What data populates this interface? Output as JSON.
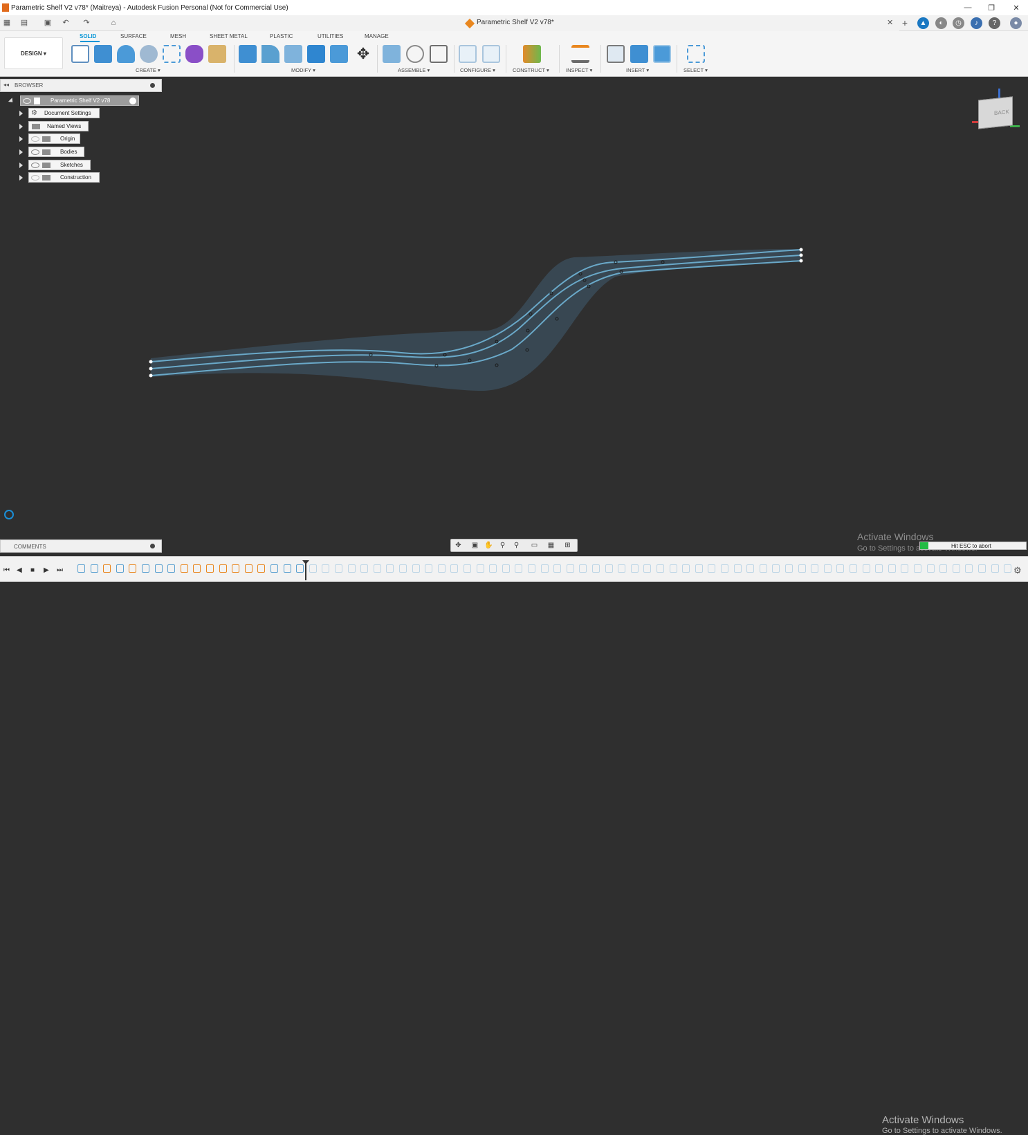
{
  "window": {
    "title": "Parametric Shelf V2 v78* (Maitreya) - Autodesk Fusion Personal (Not for Commercial Use)",
    "minimize_glyph": "—",
    "restore_glyph": "❐",
    "close_glyph": "✕"
  },
  "document_tab": {
    "label": "Parametric Shelf V2 v78*",
    "close_glyph": "✕"
  },
  "ribbon": {
    "workspace_button": "DESIGN ▾",
    "tabs": [
      "SOLID",
      "SURFACE",
      "MESH",
      "SHEET METAL",
      "PLASTIC",
      "UTILITIES",
      "MANAGE"
    ],
    "active_tab": "SOLID",
    "groups": [
      "CREATE ▾",
      "MODIFY ▾",
      "ASSEMBLE ▾",
      "CONFIGURE ▾",
      "CONSTRUCT ▾",
      "INSPECT ▾",
      "INSERT ▾",
      "SELECT ▾"
    ]
  },
  "browser": {
    "title": "BROWSER",
    "root": "Parametric Shelf V2 v78",
    "items": [
      "Document Settings",
      "Named Views",
      "Origin",
      "Bodies",
      "Sketches",
      "Construction"
    ]
  },
  "viewcube": {
    "face_label": "BACK",
    "axes": [
      "Z",
      "X",
      "Y"
    ]
  },
  "comments": {
    "title": "COMMENTS"
  },
  "status": {
    "activate_title": "Activate Windows",
    "activate_sub": "Go to Settings to activate Windows.",
    "esc_hint": "Hit ESC to abort",
    "esc_progress": 0.08
  },
  "colors": {
    "canvas": "#2f2f2f",
    "accent": "#0696d7",
    "sketch_line": "#6aa9c9",
    "sketch_fill": "#3a4a56",
    "timeline_orange": "#e9871f",
    "timeline_blue": "#5aa0d0"
  }
}
